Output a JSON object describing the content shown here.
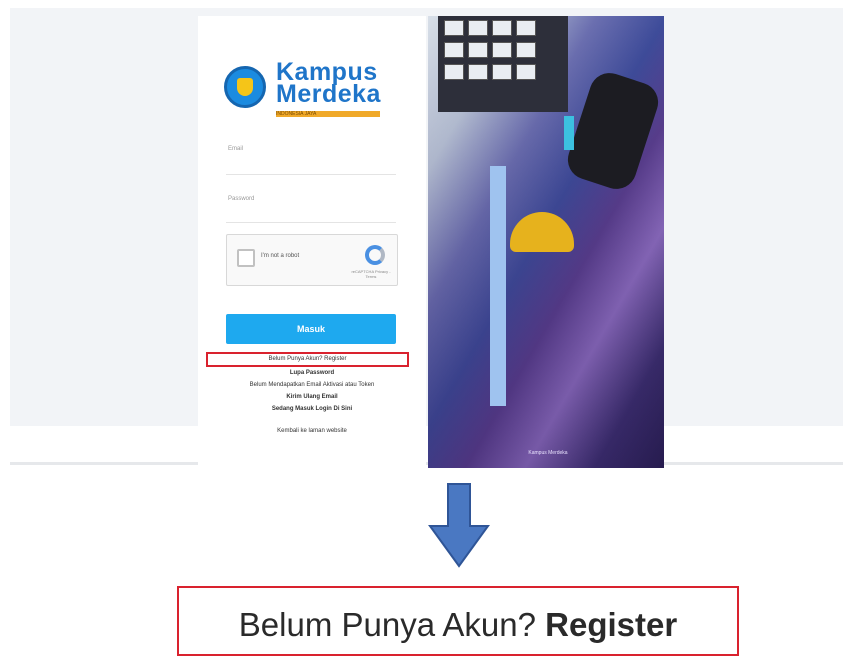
{
  "login": {
    "logo_line1": "Kampus",
    "logo_line2": "Merdeka",
    "logo_tagline": "INDONESIA JAYA",
    "email_label": "Email",
    "password_label": "Password",
    "recaptcha_label": "I'm not a robot",
    "recaptcha_terms": "reCAPTCHA Privacy - Terms",
    "masuk_label": "Masuk",
    "register_small": "Belum Punya Akun? Register",
    "lupa_password": "Lupa Password",
    "belum_email": "Belum Mendapatkan Email Aktivasi atau Token",
    "kirim_ulang": "Kirim Ulang Email",
    "sedang_login": "Sedang Masuk Login Di Sini",
    "kembali": "Kembali ke laman website"
  },
  "hero": {
    "caption": "Kampus Merdeka"
  },
  "zoom": {
    "prefix": "Belum Punya Akun?",
    "emphasis": "Register"
  },
  "colors": {
    "brand_blue": "#1f75c9",
    "button_blue": "#1ea9ef",
    "highlight_red": "#d9222e",
    "arrow_blue": "#4a78c2"
  },
  "icons": {
    "arrow": "down-arrow-icon",
    "recaptcha": "recaptcha-icon"
  }
}
